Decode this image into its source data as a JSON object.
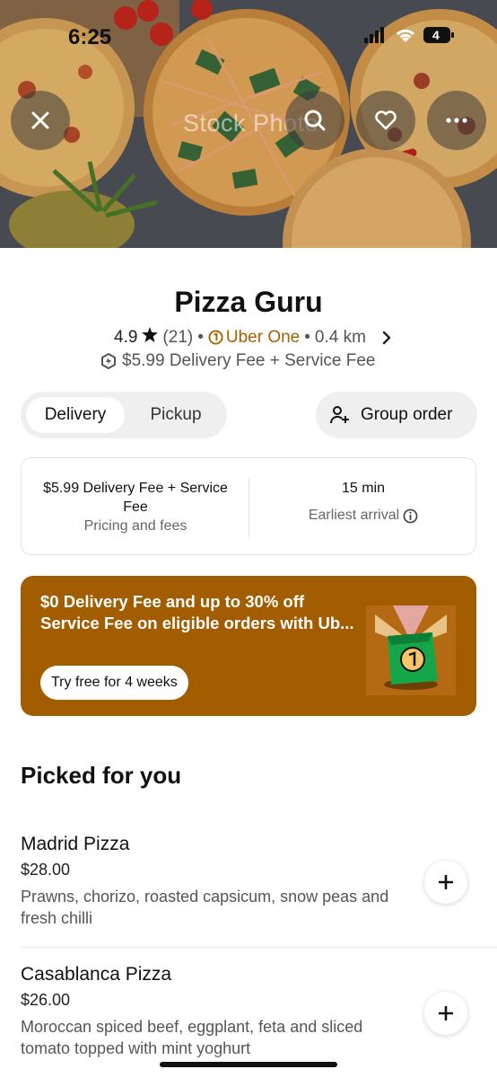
{
  "status_bar": {
    "time": "6:25",
    "battery": "4"
  },
  "hero": {
    "watermark": "Stock Photo",
    "buttons": [
      {
        "name": "close",
        "icon": "close-icon"
      },
      {
        "name": "search",
        "icon": "search-icon"
      },
      {
        "name": "favorite",
        "icon": "heart-icon"
      },
      {
        "name": "more",
        "icon": "more-icon"
      }
    ]
  },
  "store": {
    "name": "Pizza Guru",
    "rating": "4.9",
    "reviews": "(21)",
    "membership": "Uber One",
    "distance": "0.4 km",
    "fee_summary": "$5.99 Delivery Fee + Service Fee"
  },
  "mode_toggle": {
    "delivery": "Delivery",
    "pickup": "Pickup",
    "selected": "Delivery"
  },
  "group_order": {
    "label": "Group order"
  },
  "info_card": {
    "fee": "$5.99 Delivery Fee + Service Fee",
    "fee_sub": "Pricing and fees",
    "time": "15 min",
    "time_sub": "Earliest arrival"
  },
  "promo": {
    "text": "$0 Delivery Fee and up to 30% off Service Fee on eligible orders with Ub...",
    "button": "Try free for 4 weeks"
  },
  "section": {
    "title": "Picked for you"
  },
  "items": [
    {
      "name": "Madrid Pizza",
      "price": "$28.00",
      "description": "Prawns, chorizo, roasted capsicum, snow peas and fresh chilli"
    },
    {
      "name": "Casablanca Pizza",
      "price": "$26.00",
      "description": "Moroccan spiced beef, eggplant, feta and sliced tomato topped with mint yoghurt"
    }
  ],
  "colors": {
    "promo_bg": "#a25d00",
    "uber_one": "#a56200"
  }
}
